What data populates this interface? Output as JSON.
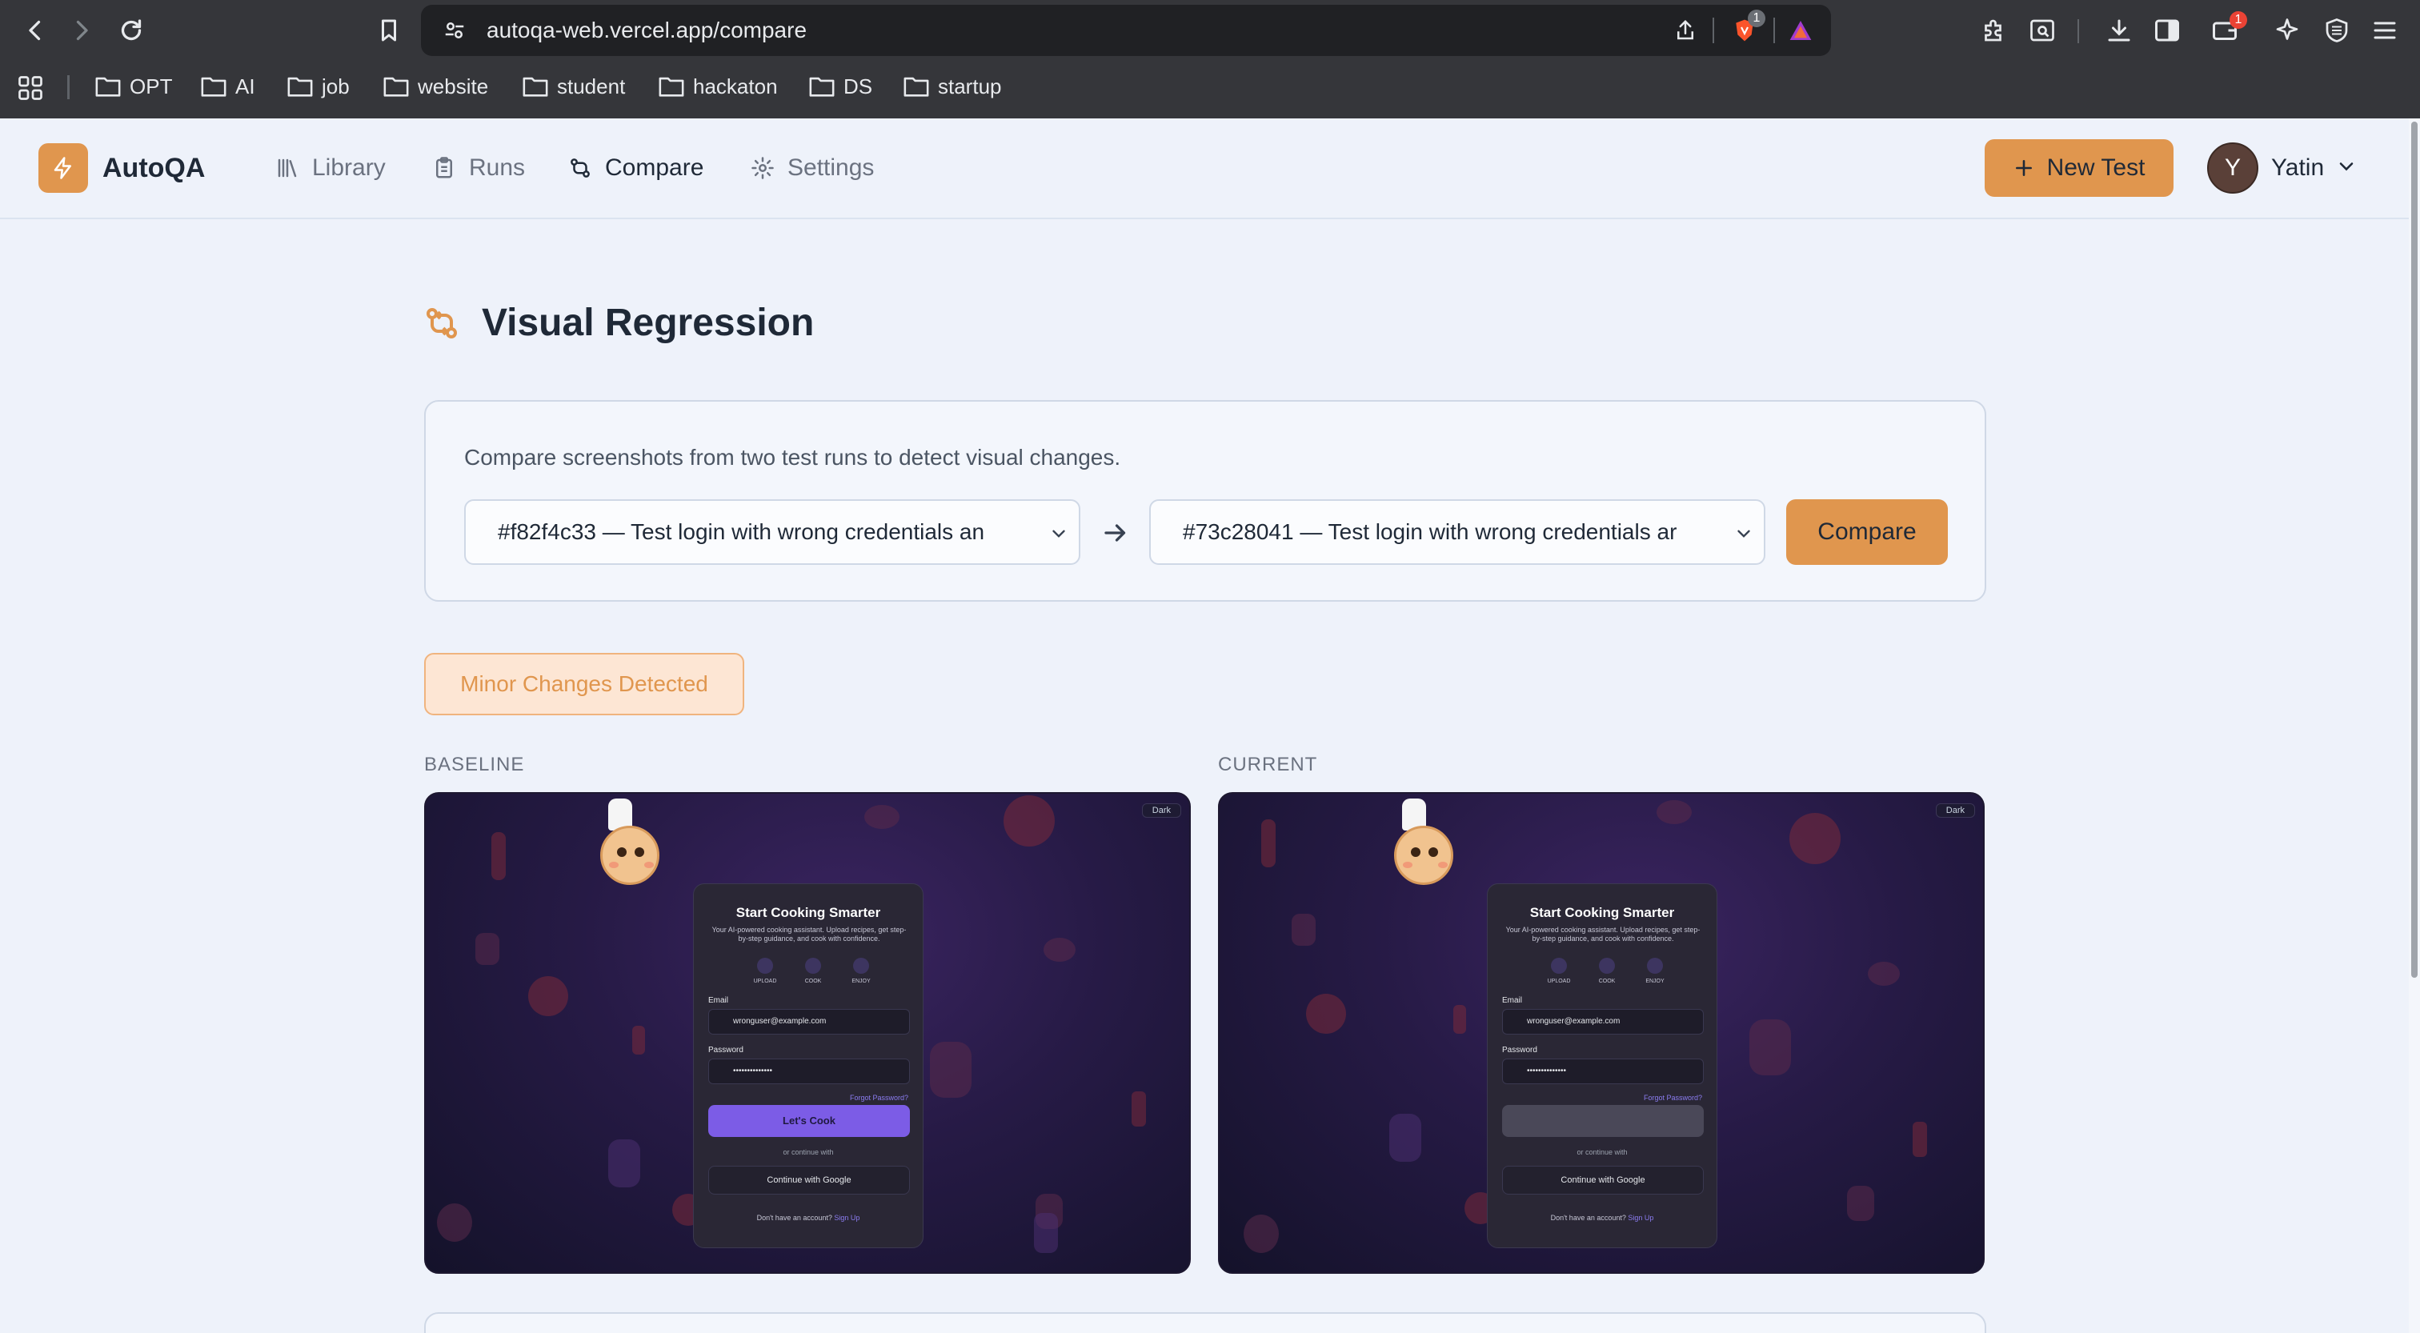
{
  "browser": {
    "url": "autoqa-web.vercel.app/compare",
    "brave_badge": "1",
    "wallet_badge": "1",
    "bookmarks": [
      "OPT",
      "AI",
      "job",
      "website",
      "student",
      "hackaton",
      "DS",
      "startup"
    ]
  },
  "app": {
    "name": "AutoQA",
    "nav": [
      {
        "label": "Library",
        "icon": "library-icon"
      },
      {
        "label": "Runs",
        "icon": "clipboard-icon"
      },
      {
        "label": "Compare",
        "icon": "compare-icon"
      },
      {
        "label": "Settings",
        "icon": "gear-icon"
      }
    ],
    "new_test_label": "New Test",
    "user": {
      "initial": "Y",
      "name": "Yatin"
    }
  },
  "page": {
    "title": "Visual Regression",
    "description": "Compare screenshots from two test runs to detect visual changes.",
    "baseline_run": "#f82f4c33 — Test login with wrong credentials an",
    "current_run": "#73c28041 — Test login with wrong credentials ar",
    "compare_label": "Compare",
    "status": "Minor Changes Detected"
  },
  "screenshots": {
    "baseline_label": "BASELINE",
    "current_label": "CURRENT",
    "mock": {
      "dark_tag": "Dark",
      "title": "Start Cooking Smarter",
      "subtitle": "Your AI-powered cooking assistant. Upload recipes, get step-by-step guidance, and cook with confidence.",
      "steps": [
        "UPLOAD",
        "COOK",
        "ENJOY"
      ],
      "email_label": "Email",
      "email_value": "wronguser@example.com",
      "password_label": "Password",
      "password_value": "••••••••••••••",
      "forgot": "Forgot Password?",
      "button": "Let's Cook",
      "or": "or continue with",
      "google": "Continue with Google",
      "signup_prompt": "Don't have an account?",
      "signup_link": "Sign Up"
    }
  },
  "colors": {
    "accent": "#e0964e",
    "badge_bg": "#fde6d4",
    "mock_button": "#7c5ce6"
  }
}
